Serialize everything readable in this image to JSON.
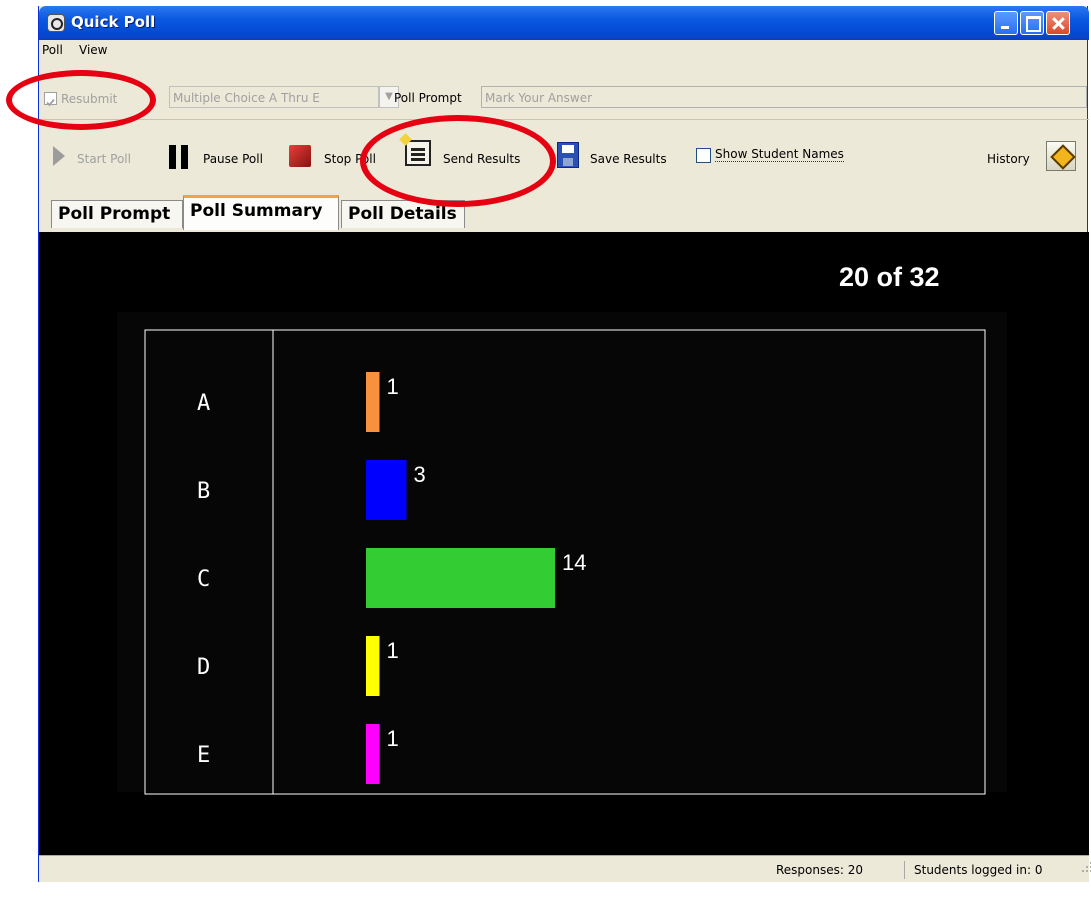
{
  "window": {
    "title": "Quick Poll"
  },
  "menu": [
    "Poll",
    "View"
  ],
  "options": {
    "resubmit_label": "Resubmit",
    "question_type": "Multiple Choice A Thru E",
    "poll_prompt_label": "Poll Prompt",
    "poll_prompt_placeholder": "Mark Your Answer"
  },
  "toolbar": {
    "start": "Start Poll",
    "pause": "Pause Poll",
    "stop": "Stop Poll",
    "send": "Send Results",
    "save": "Save Results",
    "show_names": "Show Student Names",
    "history": "History"
  },
  "tabs": [
    "Poll Prompt",
    "Poll Summary",
    "Poll Details"
  ],
  "summary": {
    "count": "20 of 32"
  },
  "chart_data": {
    "type": "bar",
    "orientation": "horizontal",
    "categories": [
      "A",
      "B",
      "C",
      "D",
      "E"
    ],
    "values": [
      1,
      3,
      14,
      1,
      1
    ],
    "colors": [
      "#f7913d",
      "#0000ff",
      "#33cc33",
      "#ffff00",
      "#ff00ff"
    ],
    "xlim": [
      0,
      14
    ],
    "grid": false
  },
  "status": {
    "responses": "Responses: 20",
    "logged_in": "Students logged in: 0"
  }
}
